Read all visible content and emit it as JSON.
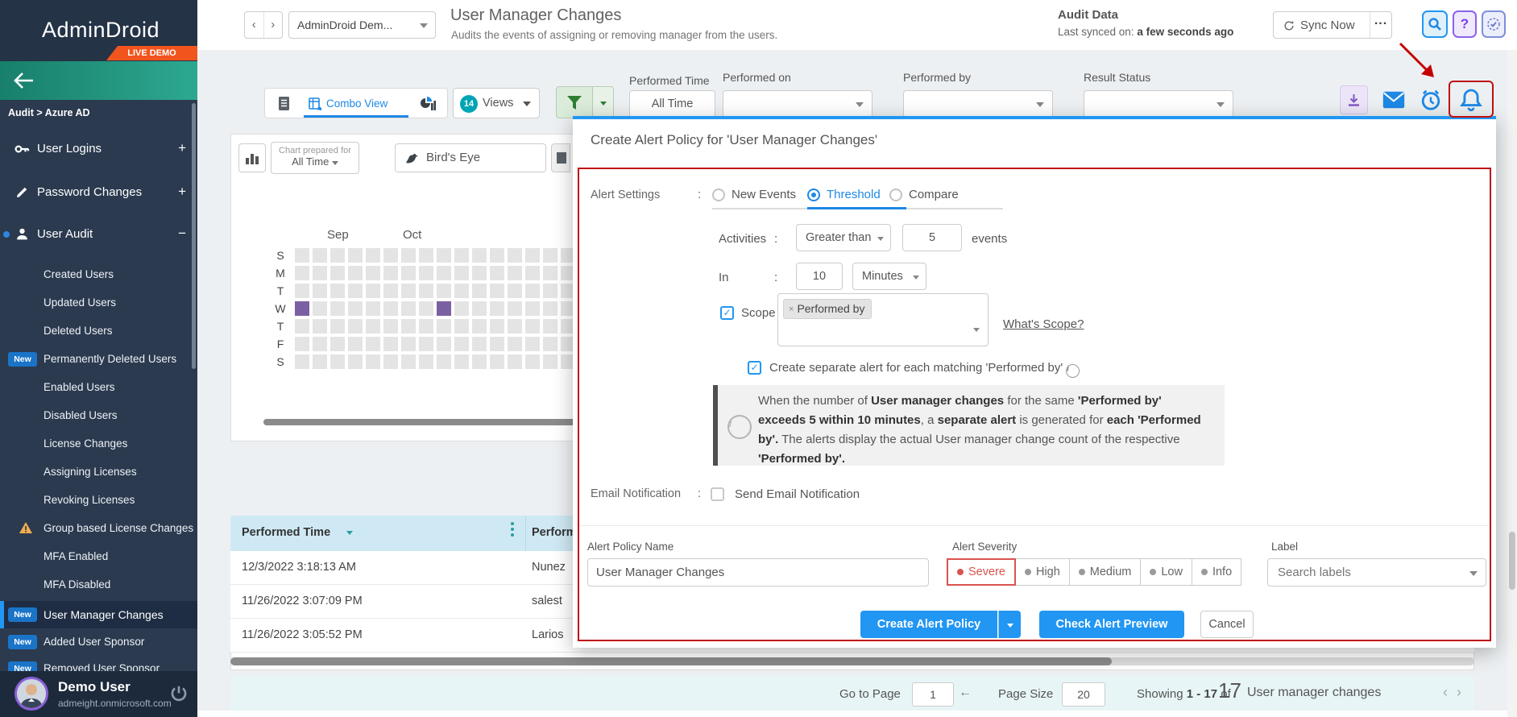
{
  "sidebar": {
    "logo_text": "AdminDroid",
    "live_demo": "LIVE DEMO",
    "breadcrumb": "Audit > Azure AD",
    "items": [
      {
        "label": "User Logins",
        "icon": "key",
        "expander": "+"
      },
      {
        "label": "Password Changes",
        "icon": "pencil",
        "expander": "+"
      },
      {
        "label": "User Audit",
        "icon": "person",
        "expander": "−"
      },
      {
        "label": "Created Users"
      },
      {
        "label": "Updated Users"
      },
      {
        "label": "Deleted Users"
      },
      {
        "label": "Permanently Deleted Users",
        "badge": "New"
      },
      {
        "label": "Enabled Users"
      },
      {
        "label": "Disabled Users"
      },
      {
        "label": "License Changes"
      },
      {
        "label": "Assigning Licenses"
      },
      {
        "label": "Revoking Licenses"
      },
      {
        "label": "Group based License Changes",
        "warning": true
      },
      {
        "label": "MFA Enabled"
      },
      {
        "label": "MFA Disabled"
      },
      {
        "label": "User Manager Changes",
        "badge": "New",
        "selected": true
      },
      {
        "label": "Added User Sponsor",
        "badge": "New"
      },
      {
        "label": "Removed User Sponsor",
        "badge": "New"
      }
    ],
    "user_name": "Demo User",
    "user_email": "admeight.onmicrosoft.com"
  },
  "header": {
    "tenant": "AdminDroid Dem...",
    "title": "User Manager Changes",
    "subtitle": "Audits the events of assigning or removing manager from the users.",
    "audit_data_label": "Audit Data",
    "last_synced_prefix": "Last synced on: ",
    "last_synced_value": "a few seconds ago",
    "sync_button": "Sync Now",
    "more_dots": "...",
    "help_glyph": "?"
  },
  "toolbar": {
    "combo_view": "Combo View",
    "views_count": "14",
    "views_label": "Views",
    "filters": [
      {
        "label": "Performed Time",
        "value": "All Time"
      },
      {
        "label": "Performed on",
        "value": ""
      },
      {
        "label": "Performed by",
        "value": ""
      },
      {
        "label": "Result Status",
        "value": ""
      }
    ]
  },
  "chart_card": {
    "prepared_for_line1": "Chart prepared for",
    "prepared_for_line2": "All Time",
    "birds_eye": "Bird's Eye",
    "months": [
      "Sep",
      "Oct"
    ],
    "day_labels": [
      "S",
      "M",
      "T",
      "W",
      "T",
      "F",
      "S"
    ],
    "heatmap": {
      "cols": 16,
      "rows": 7,
      "cell": 18,
      "gap": 4,
      "base_color": "#e4e4e4",
      "highlight_color": "#7b5fa3",
      "highlights": [
        [
          3,
          0
        ],
        [
          3,
          8
        ]
      ]
    }
  },
  "table": {
    "columns": [
      "Performed Time",
      "Performed By"
    ],
    "rows": [
      {
        "performed_time": "12/3/2022 3:18:13 AM",
        "performed_by": "Nunez"
      },
      {
        "performed_time": "11/26/2022 3:07:09 PM",
        "performed_by": "salest"
      },
      {
        "performed_time": "11/26/2022 3:05:52 PM",
        "performed_by": "Larios"
      }
    ]
  },
  "modal": {
    "title": "Create Alert Policy for 'User Manager Changes'",
    "colon": ":",
    "alert_settings_label": "Alert Settings",
    "options": [
      "New Events",
      "Threshold",
      "Compare"
    ],
    "selected_option": "Threshold",
    "activities_label": "Activities",
    "activities_operator": "Greater than",
    "activities_value": "5",
    "activities_unit": "events",
    "in_label": "In",
    "in_value": "10",
    "in_unit": "Minutes",
    "scope_label": "Scope",
    "scope_tag_remove": "×",
    "scope_tag": "Performed by",
    "whats_scope": "What's Scope?",
    "separate_alert_label": "Create separate alert for each matching 'Performed by'",
    "info_icon_glyph": "i",
    "info_parts": [
      {
        "t": "When the number of "
      },
      {
        "t": "User manager changes",
        "b": true
      },
      {
        "t": " for the same "
      },
      {
        "t": "'Performed by' exceeds 5 within 10 minutes",
        "b": true
      },
      {
        "t": ", a "
      },
      {
        "t": "separate alert",
        "b": true
      },
      {
        "t": " is generated for "
      },
      {
        "t": "each 'Performed by'.",
        "b": true
      },
      {
        "t": " The alerts display the actual User manager change count of the respective "
      },
      {
        "t": "'Performed by'.",
        "b": true
      }
    ],
    "email_label": "Email Notification",
    "email_checkbox_label": "Send Email Notification",
    "policy_name_label": "Alert Policy Name",
    "policy_name_value": "User Manager Changes",
    "severity_label": "Alert Severity",
    "severity_options": [
      {
        "label": "Severe",
        "selected": true
      },
      {
        "label": "High"
      },
      {
        "label": "Medium"
      },
      {
        "label": "Low"
      },
      {
        "label": "Info"
      }
    ],
    "label_label": "Label",
    "label_placeholder": "Search labels",
    "create_button": "Create Alert Policy",
    "preview_button": "Check Alert Preview",
    "cancel_button": "Cancel"
  },
  "footer": {
    "go_to_page": "Go to Page",
    "page_value": "1",
    "back_arrow": "←",
    "page_size": "Page Size",
    "size_value": "20",
    "showing_prefix": "Showing",
    "showing_range": "1 - 17",
    "showing_of": "of",
    "showing_total": "17",
    "showing_suffix": "User manager changes",
    "prev_glyph": "‹",
    "next_glyph": "›"
  },
  "colors": {
    "accent_blue": "#1e88e5",
    "severe_red": "#d9534f",
    "annotation_red": "#bf1010",
    "sidebar_navy": "#2b3a4f",
    "teal_bar": "#1f9c84",
    "live_demo_orange": "#f2541d"
  }
}
